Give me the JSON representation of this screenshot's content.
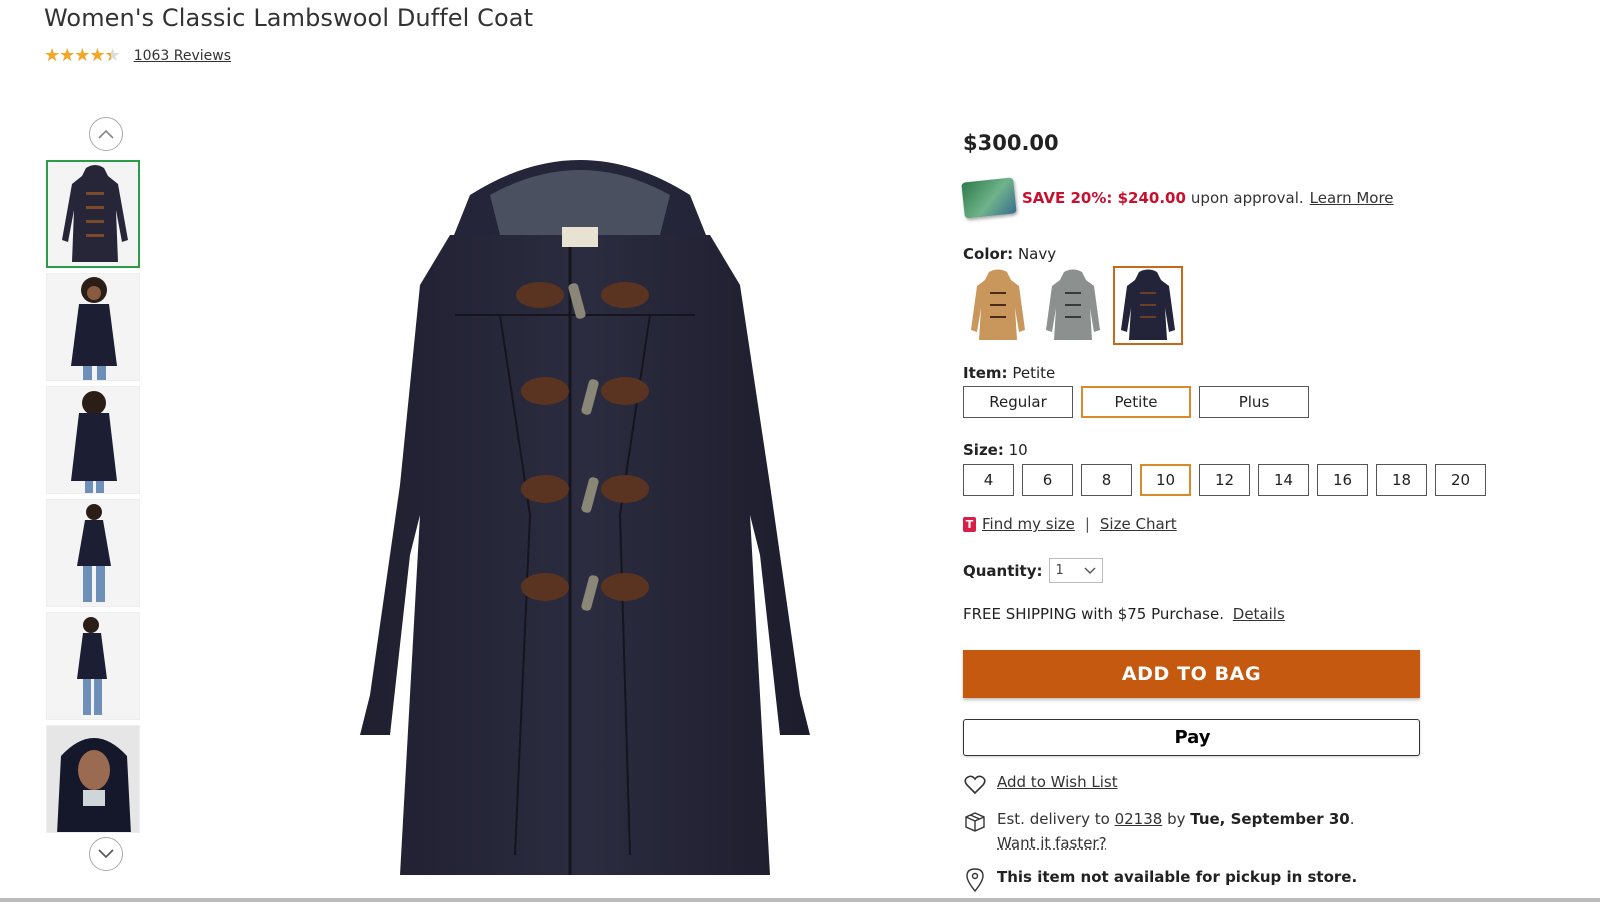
{
  "product": {
    "title": "Women's Classic Lambswool Duffel Coat",
    "rating": 4.5,
    "reviews_label": "1063 Reviews"
  },
  "thumbnails": [
    {
      "label": "navy coat front"
    },
    {
      "label": "model front"
    },
    {
      "label": "model back"
    },
    {
      "label": "model full front"
    },
    {
      "label": "model full back"
    },
    {
      "label": "model hood detail"
    }
  ],
  "pricing": {
    "price": "$300.00",
    "save_text": "SAVE 20%: $240.00",
    "approval_text": "upon approval.",
    "learn_more": "Learn More"
  },
  "color": {
    "label": "Color:",
    "selected": "Navy",
    "swatches": [
      {
        "name": "Camel",
        "hex": "#c9965c"
      },
      {
        "name": "Gray",
        "hex": "#8c918f"
      },
      {
        "name": "Navy",
        "hex": "#23243a"
      }
    ]
  },
  "item": {
    "label": "Item:",
    "selected": "Petite",
    "options": [
      "Regular",
      "Petite",
      "Plus"
    ]
  },
  "size": {
    "label": "Size:",
    "selected": "10",
    "options": [
      "4",
      "6",
      "8",
      "10",
      "12",
      "14",
      "16",
      "18",
      "20"
    ]
  },
  "fit": {
    "badge": "T",
    "find_my_size": "Find my size",
    "separator": "|",
    "size_chart": "Size Chart"
  },
  "quantity": {
    "label": "Quantity:",
    "value": "1"
  },
  "shipping": {
    "text": "FREE SHIPPING with $75 Purchase.",
    "details": "Details"
  },
  "actions": {
    "add_to_bag": "ADD TO BAG",
    "apple_pay_symbol": "",
    "apple_pay_label": "Pay",
    "wish_list": "Add to Wish List"
  },
  "delivery": {
    "prefix": "Est. delivery to",
    "zip": "02138",
    "by": "by",
    "date": "Tue, September 30",
    "period": ".",
    "faster": "Want it faster?"
  },
  "pickup": {
    "text": "This item not available for pickup in store."
  },
  "colors": {
    "accent_orange": "#c4590f",
    "selected_border": "#d98a2c",
    "promo_red": "#c8102e",
    "active_thumb": "#2e9b4a",
    "star": "#f5a623"
  }
}
